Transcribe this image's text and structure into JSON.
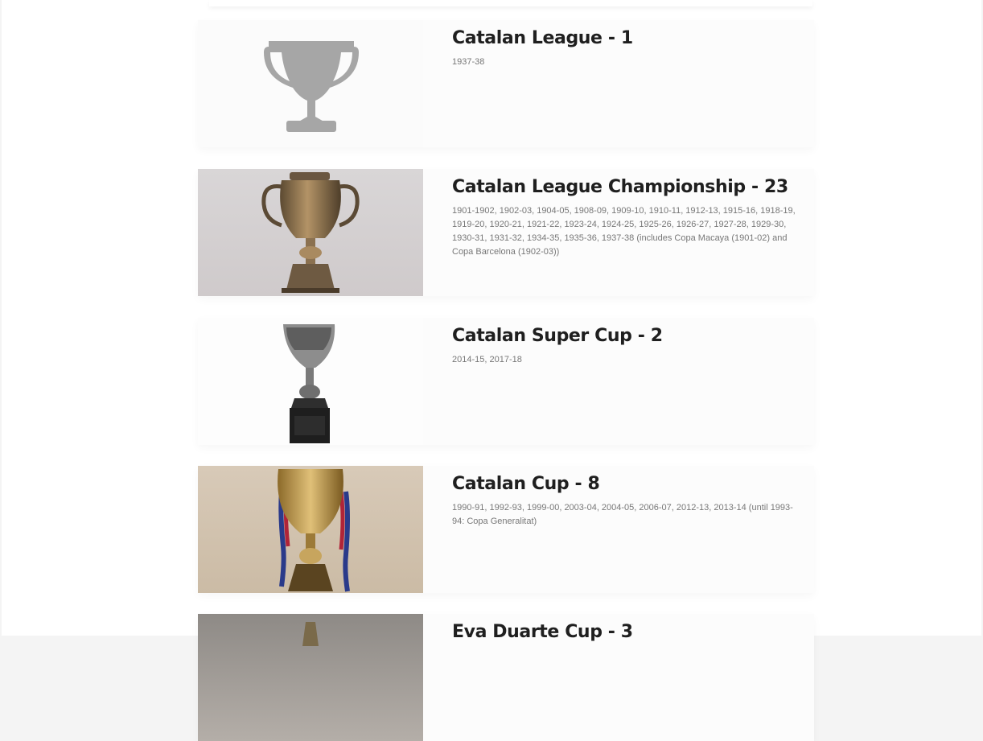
{
  "trophies": [
    {
      "title": "Catalan League - 1",
      "seasons": "1937-38",
      "image": "trophy-placeholder-icon"
    },
    {
      "title": "Catalan League Championship - 23",
      "seasons": "1901-1902, 1902-03, 1904-05, 1908-09, 1909-10, 1910-11, 1912-13, 1915-16, 1918-19, 1919-20, 1920-21, 1921-22, 1923-24, 1924-25, 1925-26, 1926-27, 1927-28, 1929-30, 1930-31, 1931-32, 1934-35, 1935-36, 1937-38 (includes Copa Macaya (1901-02) and Copa Barcelona (1902-03))",
      "image": "catalan-league-championship-trophy"
    },
    {
      "title": "Catalan Super Cup - 2",
      "seasons": "2014-15, 2017-18",
      "image": "catalan-super-cup-trophy"
    },
    {
      "title": "Catalan Cup - 8",
      "seasons": "1990-91, 1992-93, 1999-00, 2003-04, 2004-05, 2006-07, 2012-13, 2013-14 (until 1993-94: Copa Generalitat)",
      "image": "catalan-cup-trophy"
    },
    {
      "title": "Eva Duarte Cup - 3",
      "seasons": "",
      "image": "eva-duarte-cup-trophy"
    }
  ],
  "colors": {
    "page_bg": "#ffffff",
    "card_bg": "#fcfcfc",
    "title": "#1f1f1f",
    "seasons": "#777777",
    "placeholder_trophy": "#a6a6a6"
  }
}
